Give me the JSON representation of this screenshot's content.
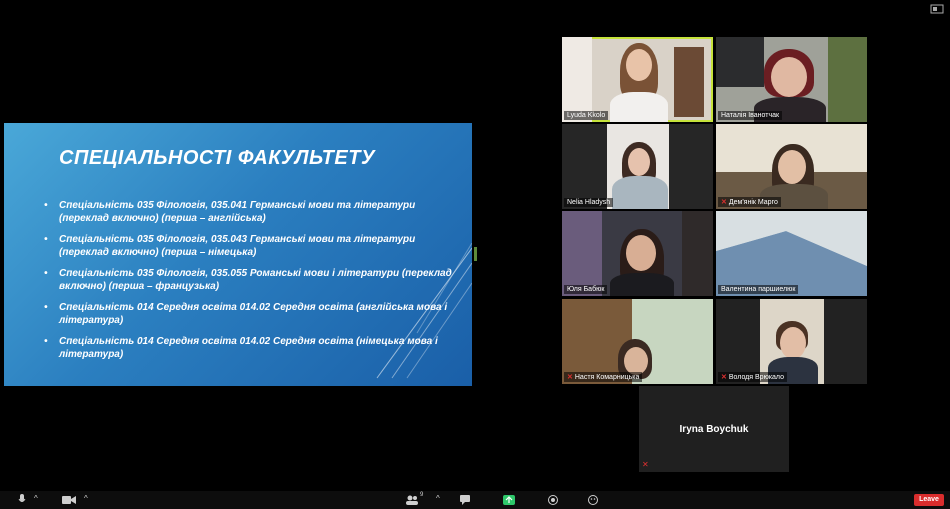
{
  "slide": {
    "title": "СПЕЦІАЛЬНОСТІ ФАКУЛЬТЕТУ",
    "bullet": "•",
    "items": [
      "Спеціальність 035 Філологія, 035.041 Германські мови та літератури (переклад включно) (перша – англійська)",
      "Спеціальність 035 Філологія, 035.043 Германські мови та літератури (переклад включно) (перша – німецька)",
      "Спеціальність 035 Філологія, 035.055 Романські мови і літератури (переклад включно) (перша – французька)",
      "Спеціальність 014 Середня освіта 014.02 Середня освіта (англійська мова і література)",
      "Спеціальність 014 Середня освіта 014.02 Середня освіта (німецька мова і література)"
    ]
  },
  "participants": [
    {
      "name": "Lyuda Kkolo",
      "muted": false
    },
    {
      "name": "Наталія Іванотчак",
      "muted": false
    },
    {
      "name": "Nelia Hladysh",
      "muted": false
    },
    {
      "name": "Дем'янік Марго",
      "muted": true
    },
    {
      "name": "Юля Бабюк",
      "muted": false
    },
    {
      "name": "Валентина паршиелюк",
      "muted": false
    },
    {
      "name": "Настя Комарницька",
      "muted": true
    },
    {
      "name": "Володя Врюкало",
      "muted": true
    }
  ],
  "name_only_participant": {
    "name": "Iryna Boychuk",
    "muted": true
  },
  "toolbar": {
    "participants_count": "9",
    "leave_label": "Leave"
  },
  "colors": {
    "active_speaker": "#c6e33b",
    "leave_button": "#d92d2d",
    "slide_top": "#4aa8d8",
    "slide_bottom": "#1a5fa8"
  }
}
